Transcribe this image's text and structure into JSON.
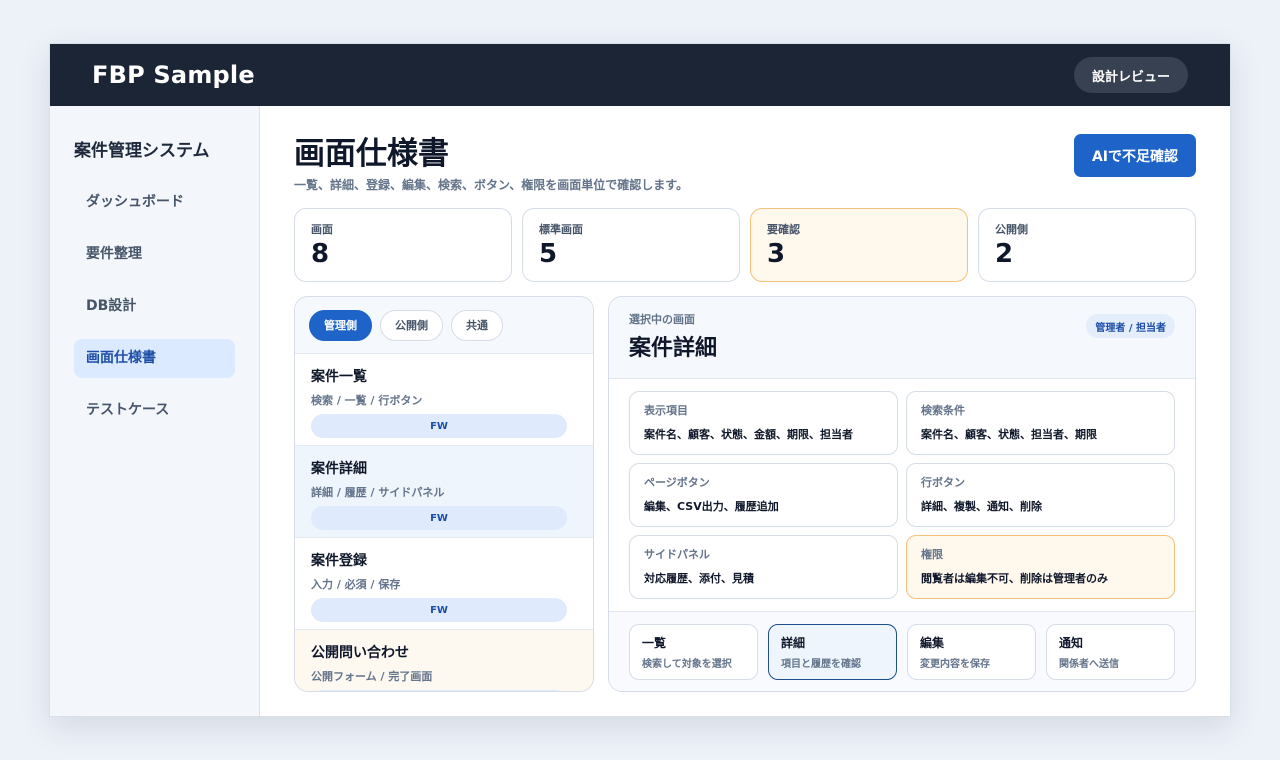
{
  "app": {
    "brand": "FBP Sample",
    "review_button": "設計レビュー"
  },
  "sidebar": {
    "title": "案件管理システム",
    "items": [
      {
        "label": "ダッシュボード"
      },
      {
        "label": "要件整理"
      },
      {
        "label": "DB設計"
      },
      {
        "label": "画面仕様書",
        "active": true
      },
      {
        "label": "テストケース"
      }
    ]
  },
  "page": {
    "title": "画面仕様書",
    "subtitle": "一覧、詳細、登録、編集、検索、ボタン、権限を画面単位で確認します。",
    "ai_button": "AIで不足確認"
  },
  "stats": [
    {
      "label": "画面",
      "value": "8"
    },
    {
      "label": "標準画面",
      "value": "5"
    },
    {
      "label": "要確認",
      "value": "3"
    },
    {
      "label": "公開側",
      "value": "2"
    }
  ],
  "list": {
    "tabs": [
      "管理側",
      "公開側",
      "共通"
    ],
    "items": [
      {
        "title": "案件一覧",
        "desc": "検索 / 一覧 / 行ボタン",
        "badge": "FW"
      },
      {
        "title": "案件詳細",
        "desc": "詳細 / 履歴 / サイドパネル",
        "badge": "FW"
      },
      {
        "title": "案件登録",
        "desc": "入力 / 必須 / 保存",
        "badge": "FW"
      },
      {
        "title": "公開問い合わせ",
        "desc": "公開フォーム / 完了画面",
        "badge": ""
      }
    ]
  },
  "detail": {
    "kicker": "選択中の画面",
    "title": "案件詳細",
    "role": "管理者 / 担当者",
    "specs": [
      {
        "label": "表示項目",
        "value": "案件名、顧客、状態、金額、期限、担当者"
      },
      {
        "label": "検索条件",
        "value": "案件名、顧客、状態、担当者、期限"
      },
      {
        "label": "ページボタン",
        "value": "編集、CSV出力、履歴追加"
      },
      {
        "label": "行ボタン",
        "value": "詳細、複製、通知、削除"
      },
      {
        "label": "サイドパネル",
        "value": "対応履歴、添付、見積"
      },
      {
        "label": "権限",
        "value": "閲覧者は編集不可、削除は管理者のみ"
      }
    ],
    "steps": [
      {
        "title": "一覧",
        "desc": "検索して対象を選択"
      },
      {
        "title": "詳細",
        "desc": "項目と履歴を確認"
      },
      {
        "title": "編集",
        "desc": "変更内容を保存"
      },
      {
        "title": "通知",
        "desc": "関係者へ送信"
      }
    ]
  },
  "colors": {
    "accent": "#1d63c8",
    "topbar": "#1c2535",
    "warn_bg": "#fff8ec",
    "warn_border": "#f3c27a"
  }
}
